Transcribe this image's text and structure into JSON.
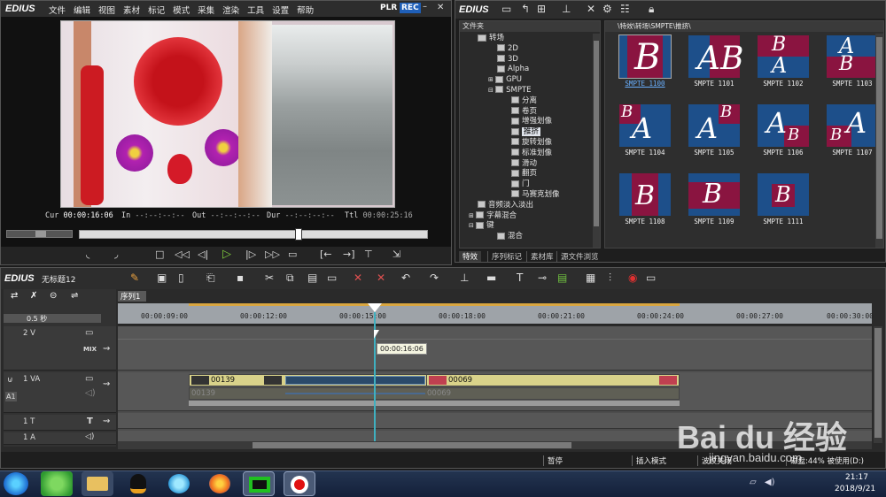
{
  "player": {
    "app_name": "EDIUS",
    "menu": [
      "文件",
      "编辑",
      "视图",
      "素材",
      "标记",
      "模式",
      "采集",
      "渲染",
      "工具",
      "设置",
      "帮助"
    ],
    "plr_label": "PLR",
    "rec_label": "REC",
    "tc_cur_label": "Cur",
    "tc_cur": "00:00:16:06",
    "tc_in_label": "In",
    "tc_in": "--:--:--:--",
    "tc_out_label": "Out",
    "tc_out": "--:--:--:--",
    "tc_dur_label": "Dur",
    "tc_dur": "--:--:--:--",
    "tc_ttl_label": "Ttl",
    "tc_ttl": "00:00:25:16"
  },
  "effects": {
    "app_name": "EDIUS",
    "folder_header": "文件夹",
    "path": "\\特效\\转场\\SMPTE\\推挤\\",
    "tree": [
      {
        "label": "转场",
        "level": 1
      },
      {
        "label": "2D",
        "level": 2
      },
      {
        "label": "3D",
        "level": 2
      },
      {
        "label": "Alpha",
        "level": 2
      },
      {
        "label": "GPU",
        "level": 2
      },
      {
        "label": "SMPTE",
        "level": 2
      },
      {
        "label": "分离",
        "level": 3
      },
      {
        "label": "卷页",
        "level": 3
      },
      {
        "label": "增强划像",
        "level": 3
      },
      {
        "label": "推挤",
        "level": 3,
        "selected": true
      },
      {
        "label": "旋转划像",
        "level": 3
      },
      {
        "label": "标准划像",
        "level": 3
      },
      {
        "label": "滑动",
        "level": 3
      },
      {
        "label": "翻页",
        "level": 3
      },
      {
        "label": "门",
        "level": 3
      },
      {
        "label": "马赛克划像",
        "level": 3
      },
      {
        "label": "音频淡入淡出",
        "level": 1
      },
      {
        "label": "字幕混合",
        "level": 1
      },
      {
        "label": "键",
        "level": 1
      },
      {
        "label": "混合",
        "level": 2
      }
    ],
    "thumbnails": [
      {
        "label": "SMPTE 1100",
        "selected": true
      },
      {
        "label": "SMPTE 1101"
      },
      {
        "label": "SMPTE 1102"
      },
      {
        "label": "SMPTE 1103"
      },
      {
        "label": "SMPTE 1104"
      },
      {
        "label": "SMPTE 1105"
      },
      {
        "label": "SMPTE 1106"
      },
      {
        "label": "SMPTE 1107"
      },
      {
        "label": "SMPTE 1108"
      },
      {
        "label": "SMPTE 1109"
      },
      {
        "label": "SMPTE 1111"
      }
    ],
    "tabs": [
      "特效",
      "序列标记",
      "素材库",
      "源文件浏览"
    ]
  },
  "timeline": {
    "app_name": "EDIUS",
    "project_name": "无标题12",
    "sequence_tab": "序列1",
    "zoom": "0.5 秒",
    "ruler_ticks": [
      "00:00:09:00",
      "00:00:12:00",
      "00:00:15:00",
      "00:00:18:00",
      "00:00:21:00",
      "00:00:24:00",
      "00:00:27:00",
      "00:00:30:00"
    ],
    "playhead_tooltip": "00:00:16:06",
    "tracks": [
      {
        "name": "2 V",
        "tag": "MIX"
      },
      {
        "name": "1 VA"
      },
      {
        "name": "1 T"
      },
      {
        "name": "1 A"
      }
    ],
    "clip1_label": "00139",
    "clip2_label": "00069",
    "clip1_audio": "00139",
    "clip2_audio": "00069"
  },
  "statusbar": {
    "pause": "暂停",
    "insert_mode": "插入模式",
    "ripple": "波纹关闭",
    "disk": "磁盘:44% 被使用(D:)"
  },
  "taskbar": {
    "time": "21:17",
    "date": "2018/9/21"
  },
  "watermark": {
    "text": "Bai du 经验",
    "url": "jingyan.baidu.com"
  }
}
